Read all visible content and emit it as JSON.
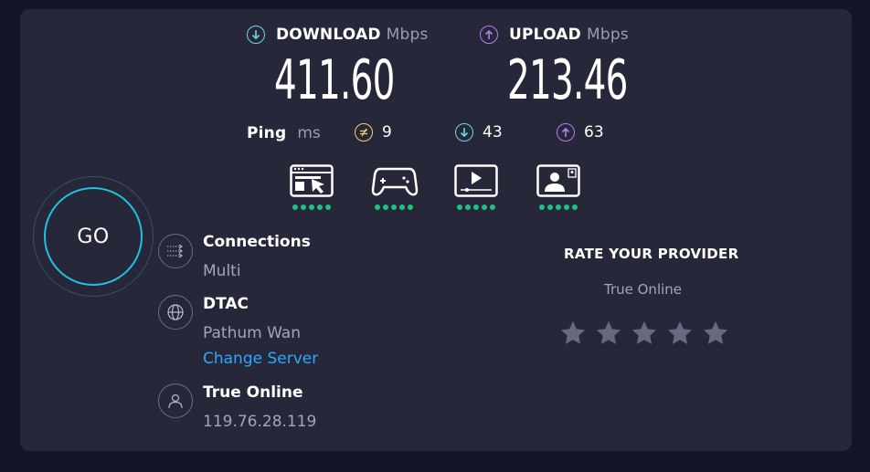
{
  "download": {
    "label": "DOWNLOAD",
    "unit": "Mbps",
    "value": "411.60",
    "color": "#6fd6e0"
  },
  "upload": {
    "label": "UPLOAD",
    "unit": "Mbps",
    "value": "213.46",
    "color": "#b77cf2"
  },
  "ping": {
    "label": "Ping",
    "unit": "ms",
    "idle": {
      "value": "9",
      "icon": "jitter-icon",
      "color": "#f3d26b"
    },
    "download": {
      "value": "43",
      "icon": "arrow-down-icon",
      "color": "#6fd6e0"
    },
    "upload": {
      "value": "63",
      "icon": "arrow-up-icon",
      "color": "#b77cf2"
    }
  },
  "experience": [
    {
      "icon": "web-browsing-icon",
      "rating": 5
    },
    {
      "icon": "gaming-icon",
      "rating": 5
    },
    {
      "icon": "video-streaming-icon",
      "rating": 5
    },
    {
      "icon": "video-chat-icon",
      "rating": 5
    }
  ],
  "go_button": {
    "label": "GO",
    "color": "#1fc2de"
  },
  "connections": {
    "title": "Connections",
    "value": "Multi"
  },
  "server": {
    "title": "DTAC",
    "location": "Pathum Wan",
    "change_label": "Change Server"
  },
  "provider": {
    "title": "True Online",
    "ip": "119.76.28.119"
  },
  "rate": {
    "title": "RATE YOUR PROVIDER",
    "provider": "True Online",
    "stars": 5
  }
}
